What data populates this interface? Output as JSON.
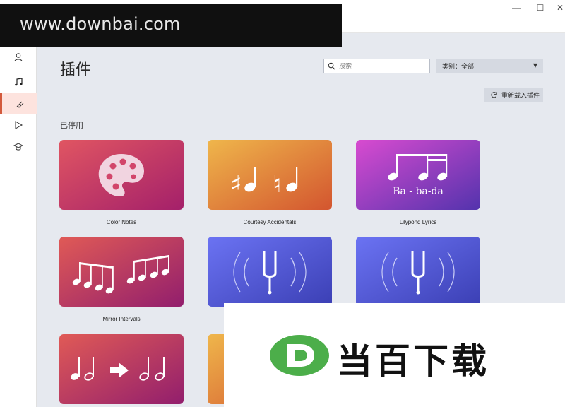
{
  "window": {
    "minimize": "—",
    "maximize": "☐",
    "close": "✕"
  },
  "watermark_top": "www.downbai.com",
  "sidebar": {
    "items": [
      {
        "icon": "user-icon"
      },
      {
        "icon": "music-note-icon"
      },
      {
        "icon": "plugin-icon",
        "active": true
      },
      {
        "icon": "play-icon"
      },
      {
        "icon": "graduation-cap-icon"
      }
    ]
  },
  "header": {
    "title": "插件",
    "search_placeholder": "搜索",
    "category_label": "类别：全部",
    "reload_label": "重新载入插件"
  },
  "section_label": "已停用",
  "plugins": [
    {
      "name": "Color Notes",
      "gradient": [
        "#e05562",
        "#a4206a"
      ]
    },
    {
      "name": "Courtesy Accidentals",
      "gradient": [
        "#efb64b",
        "#d3552f"
      ]
    },
    {
      "name": "Lilypond Lyrics",
      "gradient": [
        "#d84bd0",
        "#5333ad"
      ],
      "lyrics": "Ba - ba-da"
    },
    {
      "name": "Mirror Intervals",
      "gradient": [
        "#e05a56",
        "#921e6d"
      ]
    },
    {
      "name": "",
      "gradient": [
        "#6b73f3",
        "#3b3fb4"
      ]
    },
    {
      "name": "",
      "gradient": [
        "#6b73f3",
        "#3b3fb4"
      ]
    },
    {
      "name": "",
      "gradient": [
        "#e05a56",
        "#921e6d"
      ]
    },
    {
      "name": "",
      "gradient": [
        "#efb64b",
        "#d3552f"
      ]
    }
  ],
  "watermark_bottom": "当百下载",
  "colors": {
    "accent": "#d35a3c",
    "content_bg": "#e6e9ef",
    "watermark_green": "#4cae4a"
  }
}
